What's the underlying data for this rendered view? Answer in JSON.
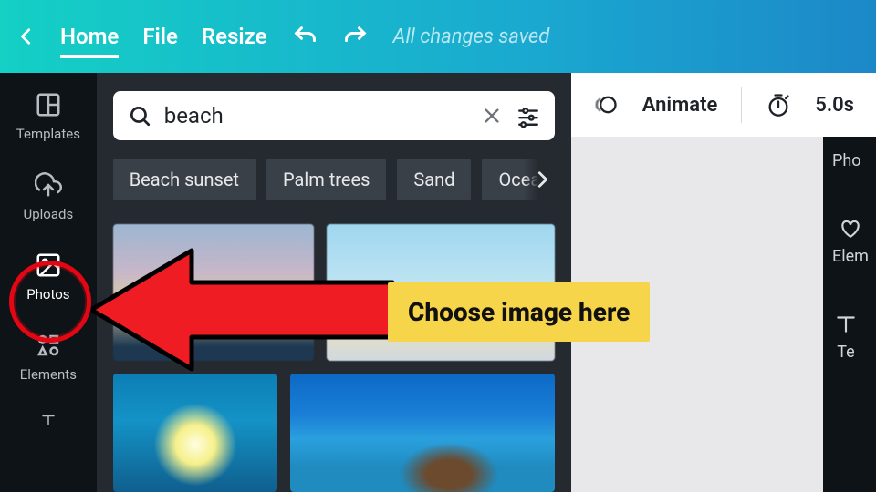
{
  "topbar": {
    "home": "Home",
    "file": "File",
    "resize": "Resize",
    "saved": "All changes saved"
  },
  "leftnav": {
    "templates": "Templates",
    "uploads": "Uploads",
    "photos": "Photos",
    "elements": "Elements"
  },
  "search": {
    "value": "beach"
  },
  "chips": [
    "Beach sunset",
    "Palm trees",
    "Sand",
    "Ocea"
  ],
  "canvas_toolbar": {
    "animate": "Animate",
    "duration": "5.0s"
  },
  "rightpeek": {
    "photos": "Pho",
    "elements": "Elem",
    "text": "Te"
  },
  "annotation": {
    "callout": "Choose image here"
  }
}
